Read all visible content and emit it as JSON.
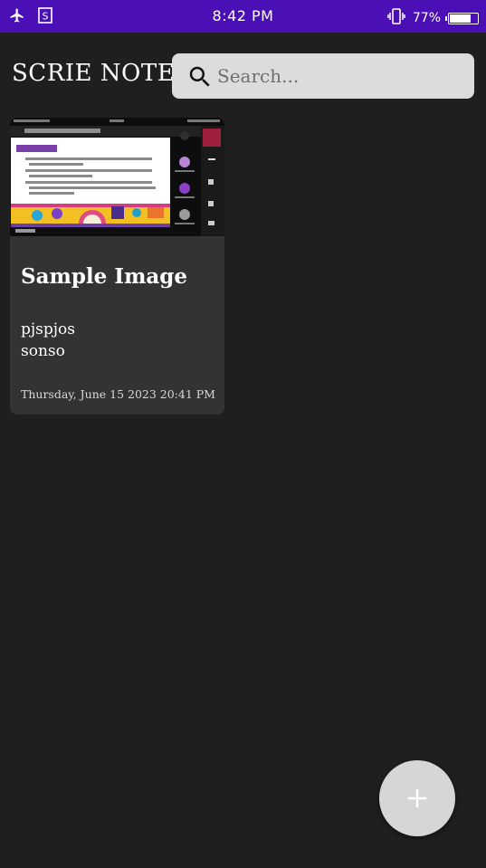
{
  "status_bar": {
    "time": "8:42 PM",
    "battery_percent": "77%",
    "battery_level": 0.77,
    "background_color": "#4a0fb5",
    "icons": [
      "airplane-icon",
      "sim-icon",
      "vibrate-icon",
      "battery-icon"
    ]
  },
  "header": {
    "app_title": "SCRIE NOTES"
  },
  "search": {
    "placeholder": "Search..."
  },
  "notes": [
    {
      "title": "Sample Image",
      "body_lines": [
        "pjspjos",
        "sonso"
      ],
      "date": "Thursday, June 15 2023 20:41 PM",
      "has_image": true
    }
  ],
  "fab": {
    "icon": "plus-icon"
  },
  "colors": {
    "background": "#1f1f1f",
    "card": "#333333",
    "search_bg": "#dcdcdc",
    "fab_bg": "#d6d6d6"
  }
}
